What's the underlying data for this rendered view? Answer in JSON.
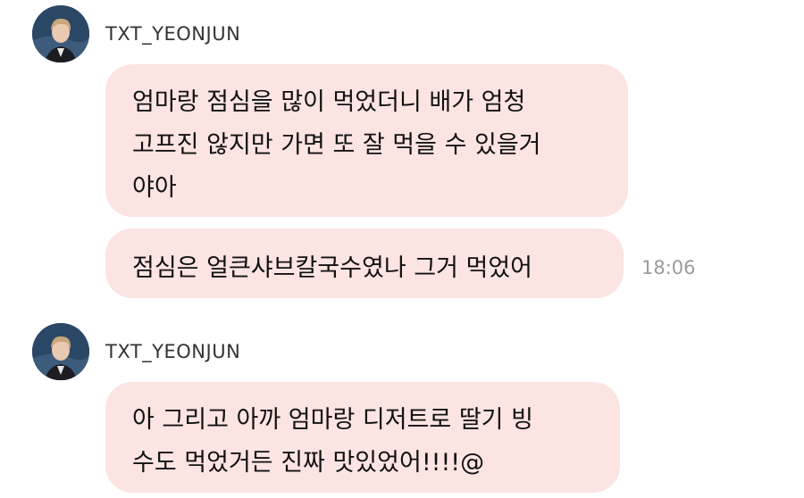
{
  "messages_group_1": {
    "sender": "TXT_YEONJUN",
    "bubble_1": {
      "lines": [
        "엄마랑 점심을 많이 먹었더니 배가 엄청",
        "고프진 않지만 가면 또 잘 먹을 수 있을거",
        "야아"
      ]
    },
    "bubble_2": {
      "lines": [
        "점심은 얼큰샤브칼국수였나 그거 먹었어"
      ],
      "time": "18:06"
    }
  },
  "messages_group_2": {
    "sender": "TXT_YEONJUN",
    "bubble_1": {
      "lines": [
        "아 그리고 아까 엄마랑 디저트로 딸기 빙",
        "수도 먹었거든 진짜 맛있었어!!!!@"
      ]
    }
  },
  "colors": {
    "bubble": "#fbe4e2",
    "name": "#333333",
    "timestamp": "#9b9b9b"
  }
}
